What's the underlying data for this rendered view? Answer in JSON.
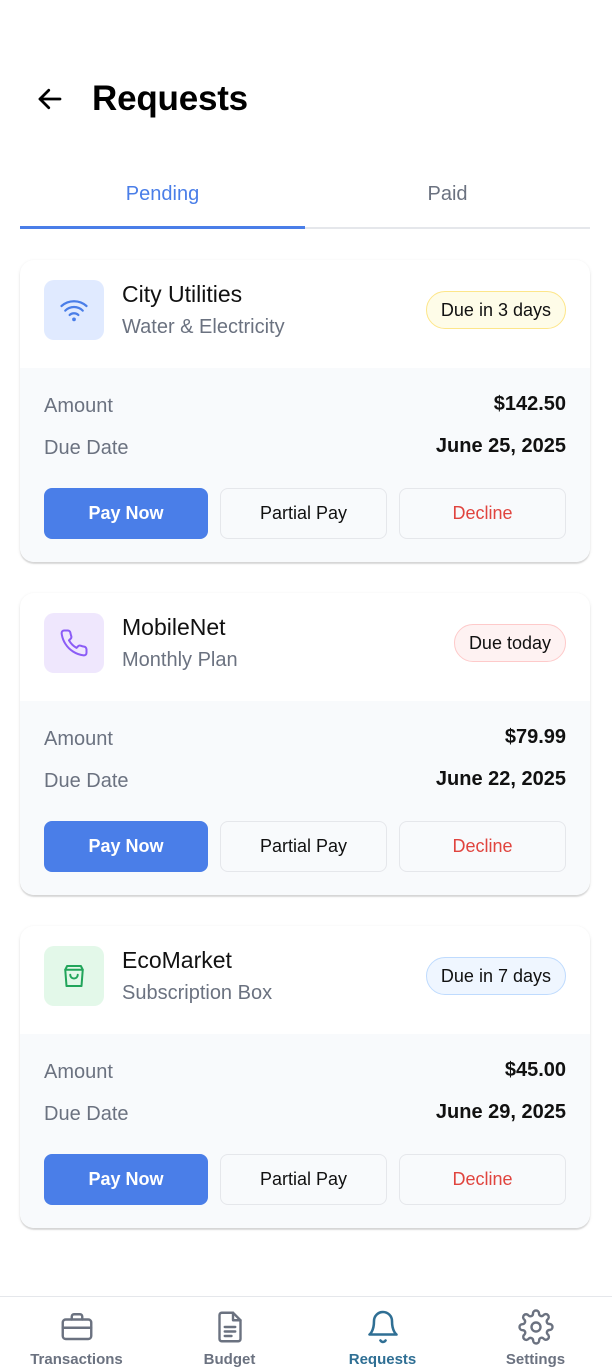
{
  "header": {
    "title": "Requests",
    "back_icon": "arrow-left-icon"
  },
  "tabs": [
    {
      "label": "Pending",
      "active": true
    },
    {
      "label": "Paid",
      "active": false
    }
  ],
  "labels": {
    "amount": "Amount",
    "due_date": "Due Date"
  },
  "buttons": {
    "pay_now": "Pay Now",
    "partial_pay": "Partial Pay",
    "decline": "Decline"
  },
  "requests": [
    {
      "name": "City Utilities",
      "description": "Water & Electricity",
      "badge": "Due in 3 days",
      "amount": "$142.50",
      "due_date": "June 25, 2025",
      "icon": "wifi-icon",
      "icon_bg": "#e0eaff",
      "icon_color": "#4a7ee8",
      "badge_bg": "#fefce8",
      "badge_border": "#fde68a"
    },
    {
      "name": "MobileNet",
      "description": "Monthly Plan",
      "badge": "Due today",
      "amount": "$79.99",
      "due_date": "June 22, 2025",
      "icon": "phone-icon",
      "icon_bg": "#efe7fd",
      "icon_color": "#8b5cf6",
      "badge_bg": "#fef2f2",
      "badge_border": "#fecaca"
    },
    {
      "name": "EcoMarket",
      "description": "Subscription Box",
      "badge": "Due in 7 days",
      "amount": "$45.00",
      "due_date": "June 29, 2025",
      "icon": "shopping-bag-icon",
      "icon_bg": "#e3f8e9",
      "icon_color": "#22a55b",
      "badge_bg": "#eff6ff",
      "badge_border": "#bfdbfe"
    }
  ],
  "nav": [
    {
      "label": "Transactions",
      "icon": "briefcase-icon",
      "active": false
    },
    {
      "label": "Budget",
      "icon": "document-icon",
      "active": false
    },
    {
      "label": "Requests",
      "icon": "bell-icon",
      "active": true
    },
    {
      "label": "Settings",
      "icon": "gear-icon",
      "active": false
    }
  ],
  "colors": {
    "accent": "#4a7ee8",
    "decline": "#e0443e",
    "nav_active": "#2f6f94",
    "nav_inactive": "#6b7280"
  }
}
